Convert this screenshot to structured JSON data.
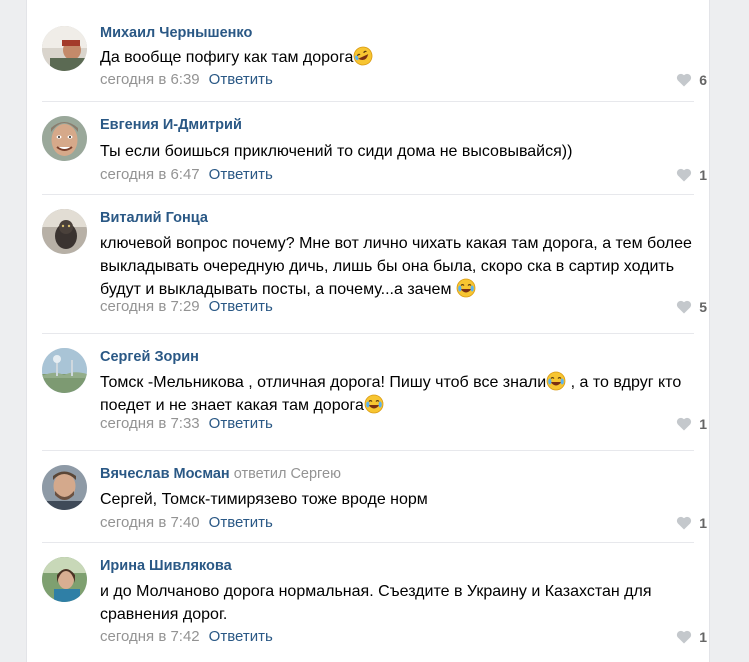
{
  "comments": [
    {
      "author": "Михаил Чернышенко",
      "reply_to": "",
      "text": "Да вообще пофигу как там дорога",
      "emoji": "rofl-emoji",
      "date": "сегодня в 6:39",
      "reply_label": "Ответить",
      "likes": "6"
    },
    {
      "author": "Евгения И-Дмитрий",
      "reply_to": "",
      "text": "Ты если боишься приключений то сиди дома не высовывайся))",
      "date": "сегодня в 6:47",
      "reply_label": "Ответить",
      "likes": "1"
    },
    {
      "author": "Виталий Гонца",
      "reply_to": "",
      "text": "ключевой вопрос почему? Мне вот лично чихать какая там дорога, а тем более выкладывать очередную дичь, лишь бы она была, скоро ска в сартир ходить будут и выкладывать посты, а почему...а зачем",
      "emoji": "tears-of-joy-emoji",
      "date": "сегодня в 7:29",
      "reply_label": "Ответить",
      "likes": "5"
    },
    {
      "author": "Сергей Зорин",
      "reply_to": "",
      "text_part1": "Томск -Мельникова , отличная дорога! Пишу чтоб все знали",
      "text_part2": " , а то вдруг кто поедет и не знает какая там дорога",
      "emoji": "tears-of-joy-emoji",
      "date": "сегодня в 7:33",
      "reply_label": "Ответить",
      "likes": "1"
    },
    {
      "author": "Вячеслав Мосман",
      "reply_to": "ответил Сергею",
      "text": "Сергей, Томск-тимирязево тоже вроде норм",
      "date": "сегодня в 7:40",
      "reply_label": "Ответить",
      "likes": "1"
    },
    {
      "author": "Ирина Шивлякова",
      "reply_to": "",
      "text": "и до Молчаново дорога нормальная. Съездите в Украину и Казахстан для сравнения дорог.",
      "date": "сегодня в 7:42",
      "reply_label": "Ответить",
      "likes": "1"
    }
  ],
  "colors": {
    "author": "#2a5885",
    "muted": "#939393",
    "like_icon": "#c4c8cc",
    "background": "#edeef0"
  },
  "icons": {
    "like": "heart-icon"
  }
}
